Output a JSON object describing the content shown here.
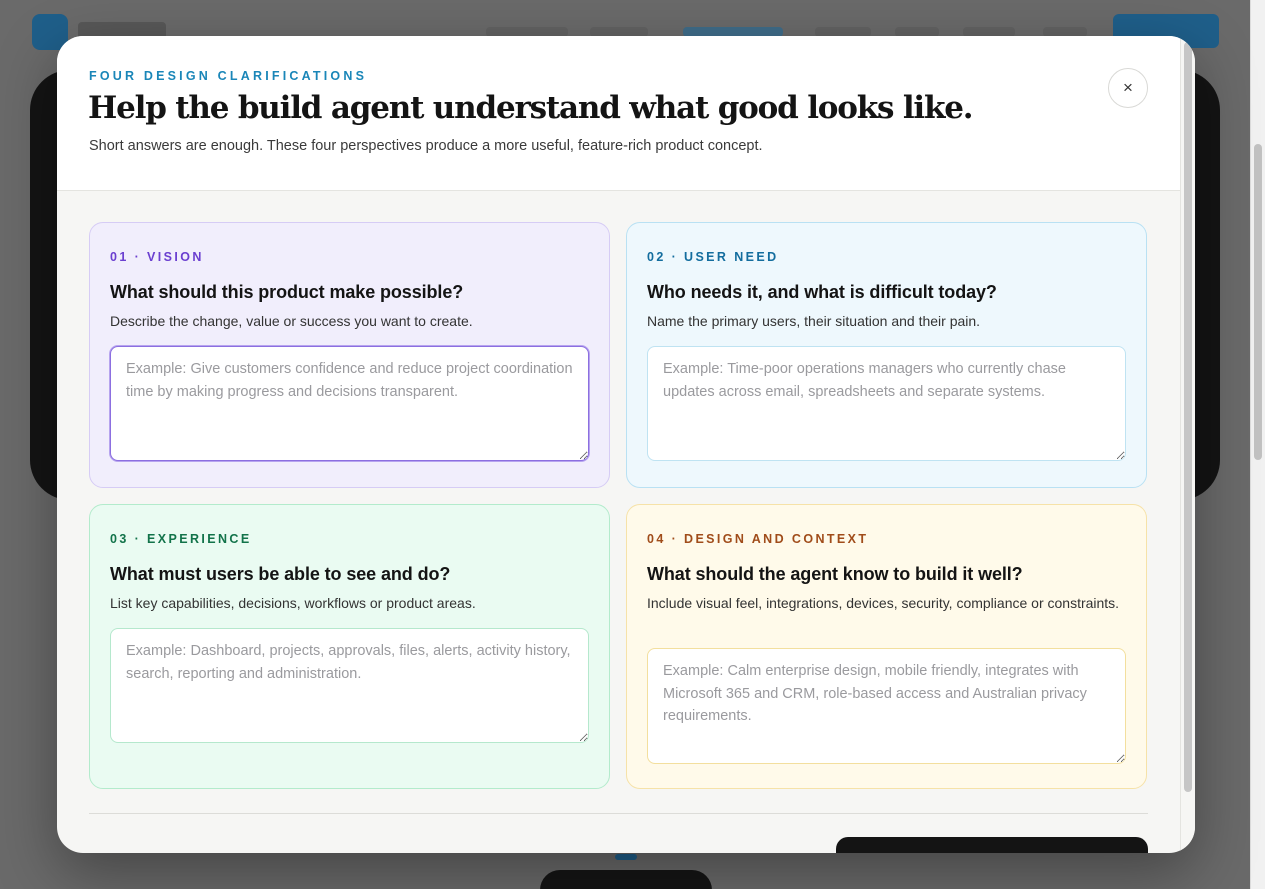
{
  "dialog": {
    "eyebrow": "FOUR DESIGN CLARIFICATIONS",
    "title": "Help the build agent understand what good looks like.",
    "subtitle": "Short answers are enough. These four perspectives produce a more useful, feature-rich product concept.",
    "close_label": "×"
  },
  "cards": [
    {
      "tag": "01 · VISION",
      "question": "What should this product make possible?",
      "help": "Describe the change, value or success you want to create.",
      "value": "",
      "placeholder": "Example: Give customers confidence and reduce project coordination time by making progress and decisions transparent.",
      "accent": "#6b3fd0"
    },
    {
      "tag": "02 · USER NEED",
      "question": "Who needs it, and what is difficult today?",
      "help": "Name the primary users, their situation and their pain.",
      "value": "",
      "placeholder": "Example: Time-poor operations managers who currently chase updates across email, spreadsheets and separate systems.",
      "accent": "#136d9e"
    },
    {
      "tag": "03 · EXPERIENCE",
      "question": "What must users be able to see and do?",
      "help": "List key capabilities, decisions, workflows or product areas.",
      "value": "",
      "placeholder": "Example: Dashboard, projects, approvals, files, alerts, activity history, search, reporting and administration.",
      "accent": "#12734a"
    },
    {
      "tag": "04 · DESIGN AND CONTEXT",
      "question": "What should the agent know to build it well?",
      "help": "Include visual feel, integrations, devices, security, compliance or constraints.",
      "value": "",
      "placeholder": "Example: Calm enterprise design, mobile friendly, integrates with Microsoft 365 and CRM, role-based access and Australian privacy requirements.",
      "accent": "#a04c1a"
    }
  ],
  "colors": {
    "brand": "#1a86b8",
    "primary_button": "#141414",
    "overlay": "#6a6a6a"
  }
}
